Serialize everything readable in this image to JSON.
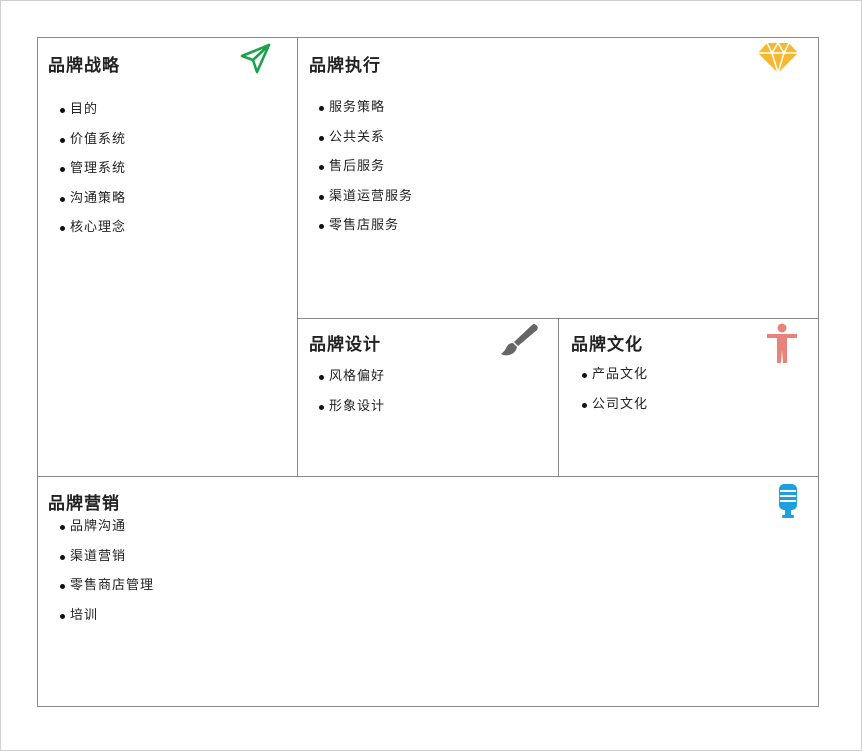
{
  "strategy": {
    "title": "品牌战略",
    "icon": "paper-plane-icon",
    "items": [
      "目的",
      "价值系统",
      "管理系统",
      "沟通策略",
      "核心理念"
    ]
  },
  "execution": {
    "title": "品牌执行",
    "icon": "diamond-icon",
    "items": [
      "服务策略",
      "公共关系",
      "售后服务",
      "渠道运营服务",
      "零售店服务"
    ]
  },
  "design": {
    "title": "品牌设计",
    "icon": "paintbrush-icon",
    "items": [
      "风格偏好",
      "形象设计"
    ]
  },
  "culture": {
    "title": "品牌文化",
    "icon": "person-icon",
    "items": [
      "产品文化",
      "公司文化"
    ]
  },
  "marketing": {
    "title": "品牌营销",
    "icon": "microphone-icon",
    "items": [
      "品牌沟通",
      "渠道营销",
      "零售商店管理",
      "培训"
    ]
  },
  "colors": {
    "plane": "#1aa34a",
    "diamond": "#f5b82e",
    "brush": "#666666",
    "person": "#e8837c",
    "mic": "#1ba1e2",
    "border": "#8a8a8a"
  }
}
